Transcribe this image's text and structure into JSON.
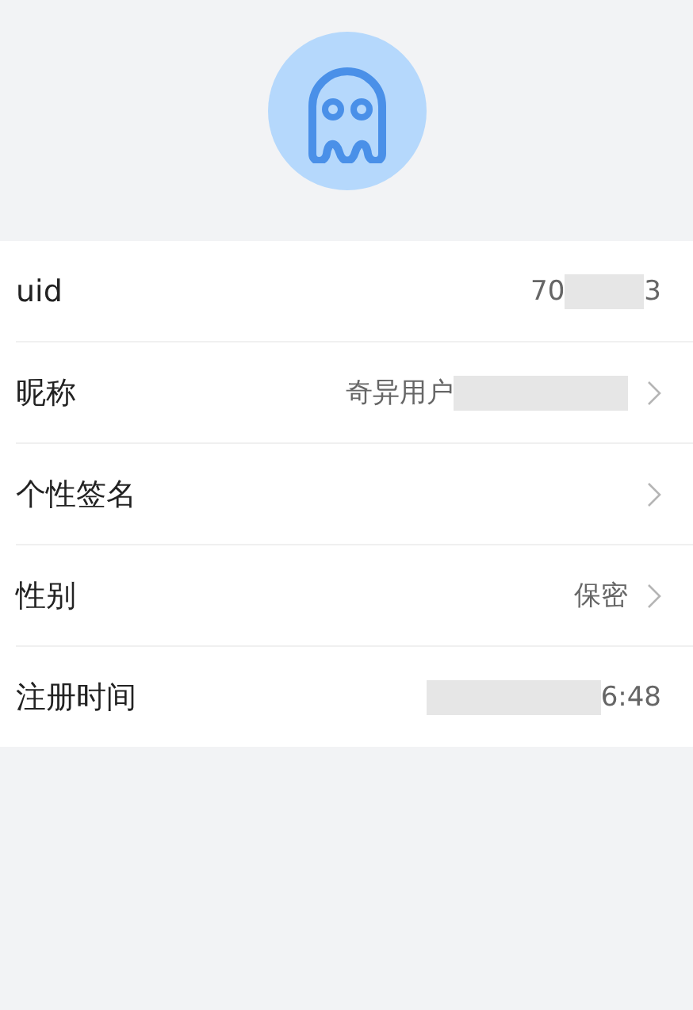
{
  "avatar": {
    "kind": "ghost"
  },
  "rows": [
    {
      "label": "uid",
      "value_parts": [
        {
          "kind": "text",
          "text": "70"
        },
        {
          "kind": "redacted"
        },
        {
          "kind": "text",
          "text": "3"
        }
      ],
      "arrow": false
    },
    {
      "label": "昵称",
      "value_parts": [
        {
          "kind": "text",
          "text": "奇异用户"
        },
        {
          "kind": "redacted"
        }
      ],
      "arrow": true
    },
    {
      "label": "个性签名",
      "value_parts": [],
      "arrow": true
    },
    {
      "label": "性别",
      "value_parts": [
        {
          "kind": "text",
          "text": "保密"
        }
      ],
      "arrow": true
    },
    {
      "label": "注册时间",
      "value_parts": [
        {
          "kind": "redacted"
        },
        {
          "kind": "text",
          "text": "6:48"
        }
      ],
      "arrow": false
    }
  ]
}
